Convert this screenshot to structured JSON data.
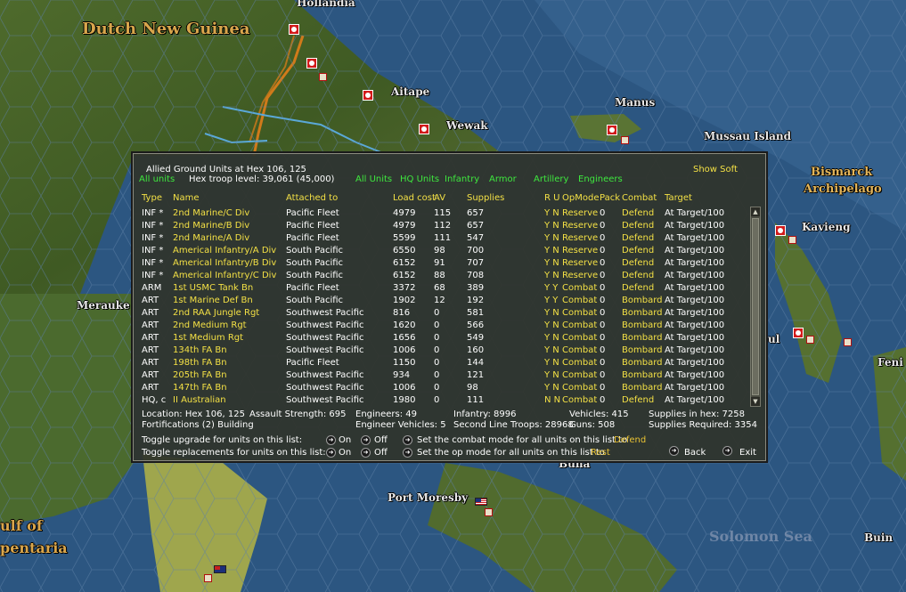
{
  "map": {
    "labels": {
      "hollandia": "Hollandia",
      "dutch_new_guinea": "Dutch New Guinea",
      "aitape": "Aitape",
      "wewak": "Wewak",
      "manus": "Manus",
      "mussau_island": "Mussau Island",
      "bismarck_line1": "Bismarck",
      "bismarck_line2": "Archipelago",
      "kavieng": "Kavieng",
      "merauke": "Merauke",
      "buna": "Buna",
      "port_moresby": "Port Moresby",
      "solomon_sea": "Solomon Sea",
      "gulf_line1": "ulf of",
      "gulf_line2": "pentaria",
      "feni": "Feni I",
      "buin": "Buin",
      "rabaul_partial": "ul"
    }
  },
  "dialog": {
    "title": "Allied Ground Units at Hex 106, 125",
    "show_soft": "Show Soft",
    "filter_all_units_left": "All units",
    "hex_troop_level": "Hex troop level: 39,061  (45,000)",
    "filters": [
      "All Units",
      "HQ Units",
      "Infantry",
      "Armor",
      "Artillery",
      "Engineers"
    ],
    "columns": {
      "type": "Type",
      "name": "Name",
      "attached_to": "Attached to",
      "load_cost": "Load cost",
      "av": "AV",
      "supplies": "Supplies",
      "ru": "R U",
      "opmode": "OpMode",
      "pack": "Pack",
      "combat": "Combat",
      "target": "Target"
    },
    "rows": [
      {
        "type": "INF *",
        "name": "2nd Marine/C Div",
        "attached": "Pacific Fleet",
        "load": "4979",
        "av": "115",
        "supplies": "657",
        "ru": "Y N",
        "opmode": "Reserve",
        "pack": "0",
        "combat": "Defend",
        "target": "At Target/100"
      },
      {
        "type": "INF *",
        "name": "2nd Marine/B Div",
        "attached": "Pacific Fleet",
        "load": "4979",
        "av": "112",
        "supplies": "657",
        "ru": "Y N",
        "opmode": "Reserve",
        "pack": "0",
        "combat": "Defend",
        "target": "At Target/100"
      },
      {
        "type": "INF *",
        "name": "2nd Marine/A Div",
        "attached": "Pacific Fleet",
        "load": "5599",
        "av": "111",
        "supplies": "547",
        "ru": "Y N",
        "opmode": "Reserve",
        "pack": "0",
        "combat": "Defend",
        "target": "At Target/100"
      },
      {
        "type": "INF *",
        "name": "Americal Infantry/A Div",
        "attached": "South Pacific",
        "load": "6550",
        "av": "98",
        "supplies": "700",
        "ru": "Y N",
        "opmode": "Reserve",
        "pack": "0",
        "combat": "Defend",
        "target": "At Target/100"
      },
      {
        "type": "INF *",
        "name": "Americal Infantry/B Div",
        "attached": "South Pacific",
        "load": "6152",
        "av": "91",
        "supplies": "707",
        "ru": "Y N",
        "opmode": "Reserve",
        "pack": "0",
        "combat": "Defend",
        "target": "At Target/100"
      },
      {
        "type": "INF *",
        "name": "Americal Infantry/C Div",
        "attached": "South Pacific",
        "load": "6152",
        "av": "88",
        "supplies": "708",
        "ru": "Y N",
        "opmode": "Reserve",
        "pack": "0",
        "combat": "Defend",
        "target": "At Target/100"
      },
      {
        "type": "ARM",
        "name": "1st USMC Tank Bn",
        "attached": "Pacific Fleet",
        "load": "3372",
        "av": "68",
        "supplies": "389",
        "ru": "Y Y",
        "opmode": "Combat",
        "pack": "0",
        "combat": "Defend",
        "target": "At Target/100"
      },
      {
        "type": "ART",
        "name": "1st Marine Def Bn",
        "attached": "South Pacific",
        "load": "1902",
        "av": "12",
        "supplies": "192",
        "ru": "Y Y",
        "opmode": "Combat",
        "pack": "0",
        "combat": "Bombard",
        "target": "At Target/100"
      },
      {
        "type": "ART",
        "name": "2nd RAA Jungle Rgt",
        "attached": "Southwest Pacific",
        "load": "816",
        "av": "0",
        "supplies": "581",
        "ru": "Y N",
        "opmode": "Combat",
        "pack": "0",
        "combat": "Bombard",
        "target": "At Target/100"
      },
      {
        "type": "ART",
        "name": "2nd Medium Rgt",
        "attached": "Southwest Pacific",
        "load": "1620",
        "av": "0",
        "supplies": "566",
        "ru": "Y N",
        "opmode": "Combat",
        "pack": "0",
        "combat": "Bombard",
        "target": "At Target/100"
      },
      {
        "type": "ART",
        "name": "1st Medium Rgt",
        "attached": "Southwest Pacific",
        "load": "1656",
        "av": "0",
        "supplies": "549",
        "ru": "Y N",
        "opmode": "Combat",
        "pack": "0",
        "combat": "Bombard",
        "target": "At Target/100"
      },
      {
        "type": "ART",
        "name": "134th FA Bn",
        "attached": "Southwest Pacific",
        "load": "1006",
        "av": "0",
        "supplies": "160",
        "ru": "Y N",
        "opmode": "Combat",
        "pack": "0",
        "combat": "Bombard",
        "target": "At Target/100"
      },
      {
        "type": "ART",
        "name": "198th FA Bn",
        "attached": "Pacific Fleet",
        "load": "1150",
        "av": "0",
        "supplies": "144",
        "ru": "Y N",
        "opmode": "Combat",
        "pack": "0",
        "combat": "Bombard",
        "target": "At Target/100"
      },
      {
        "type": "ART",
        "name": "205th FA Bn",
        "attached": "Southwest Pacific",
        "load": "934",
        "av": "0",
        "supplies": "121",
        "ru": "Y N",
        "opmode": "Combat",
        "pack": "0",
        "combat": "Bombard",
        "target": "At Target/100"
      },
      {
        "type": "ART",
        "name": "147th FA Bn",
        "attached": "Southwest Pacific",
        "load": "1006",
        "av": "0",
        "supplies": "98",
        "ru": "Y N",
        "opmode": "Combat",
        "pack": "0",
        "combat": "Bombard",
        "target": "At Target/100"
      },
      {
        "type": "HQ, c",
        "name": "II Australian",
        "attached": "Southwest Pacific",
        "load": "1980",
        "av": "0",
        "supplies": "111",
        "ru": "N N",
        "opmode": "Combat",
        "pack": "0",
        "combat": "Defend",
        "target": "At Target/100"
      }
    ],
    "summary": {
      "location": "Location: Hex 106, 125",
      "assault_strength": "Assault Strength: 695",
      "engineers": "Engineers: 49",
      "infantry": "Infantry: 8996",
      "vehicles": "Vehicles: 415",
      "supplies_in_hex": "Supplies in hex: 7258",
      "fortifications": "Fortifications (2) Building",
      "engineer_vehicles": "Engineer Vehicles: 5",
      "second_line": "Second Line Troops: 28968",
      "guns": "Guns: 508",
      "supplies_required": "Supplies Required: 3354"
    },
    "controls": {
      "toggle_upgrade": "Toggle upgrade for units on this list:",
      "toggle_replacements": "Toggle replacements for units on this list:",
      "on": "On",
      "off": "Off",
      "set_combat_mode": "Set the combat mode for all units on this list to",
      "combat_mode_value": "Defend",
      "set_op_mode": "Set the op mode for all units on this list to",
      "op_mode_value": "Rest",
      "back": "Back",
      "exit": "Exit"
    }
  }
}
